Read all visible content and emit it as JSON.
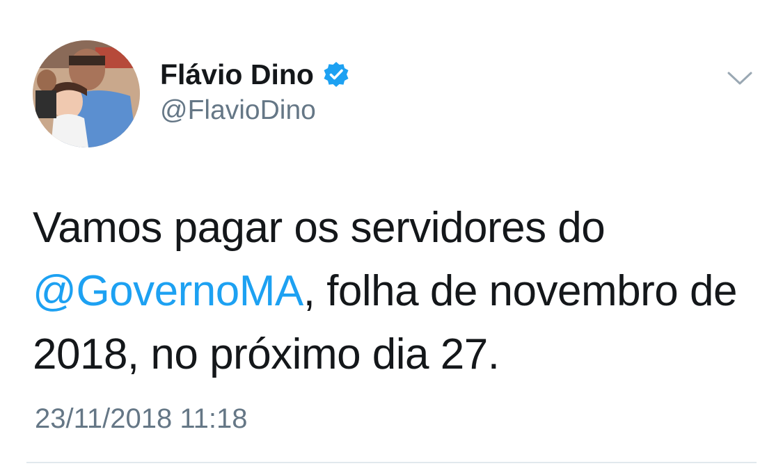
{
  "tweet": {
    "author": {
      "display_name": "Flávio Dino",
      "handle": "@FlavioDino",
      "verified": true,
      "avatar_icon": "profile-photo"
    },
    "menu_icon": "chevron-down-icon",
    "text_before": "Vamos pagar os servidores do ",
    "mention": "@GovernoMA",
    "text_after": ", folha de novembro de 2018, no próximo dia 27.",
    "timestamp": "23/11/2018 11:18"
  },
  "colors": {
    "text": "#14171a",
    "secondary": "#657786",
    "link": "#1da1f2",
    "verified_badge": "#1da1f2",
    "divider": "#e1e8ed"
  }
}
